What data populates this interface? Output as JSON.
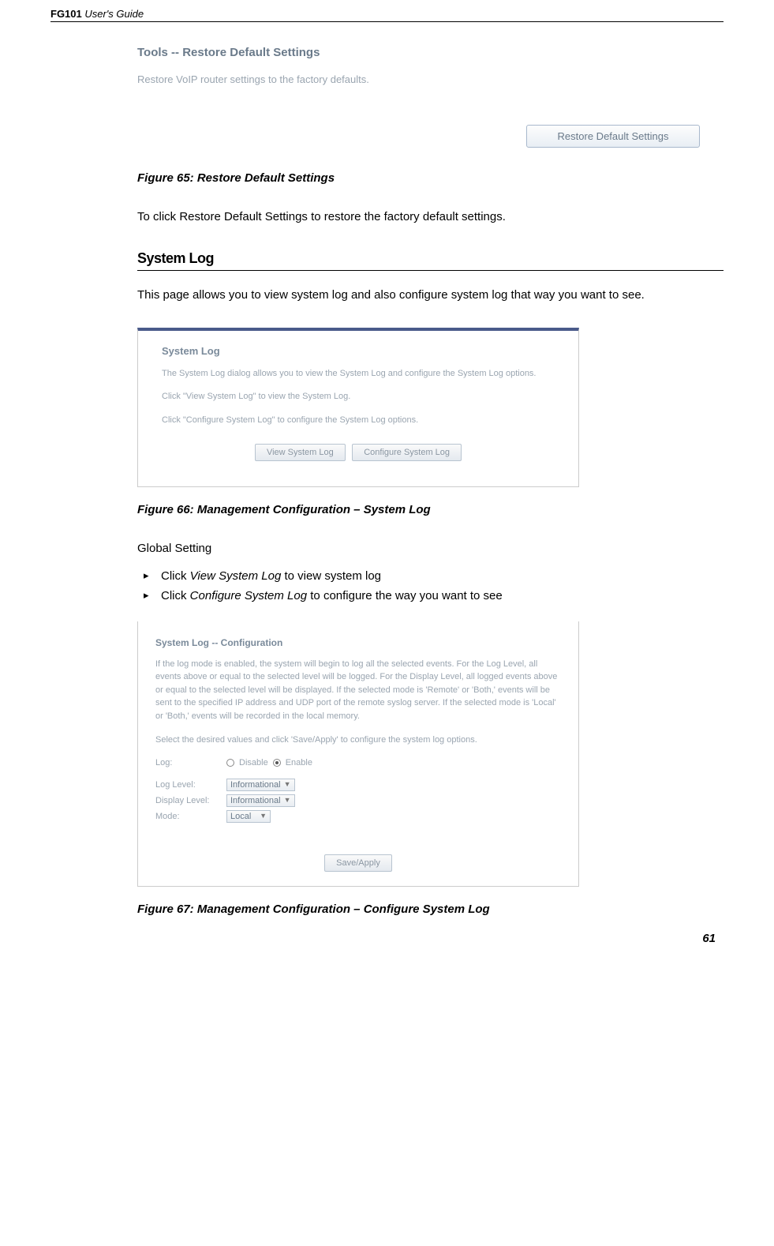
{
  "header": {
    "product": "FG101",
    "subtitle": "User's Guide"
  },
  "restore": {
    "title": "Tools -- Restore Default Settings",
    "desc": "Restore VoIP router settings to the factory defaults.",
    "button": "Restore Default Settings"
  },
  "figure65_caption": "Figure 65: Restore Default Settings",
  "restore_body": "To click Restore Default Settings to restore the factory default settings.",
  "section_heading": "System Log",
  "syslog_intro": "This page allows you to view system log and also configure system log that way you want to see.",
  "syslog": {
    "title": "System Log",
    "line1": "The System Log dialog allows you to view the System Log and configure the System Log options.",
    "line2": "Click \"View System Log\" to view the System Log.",
    "line3": "Click \"Configure System Log\" to configure the System Log options.",
    "btn_view": "View System Log",
    "btn_config": "Configure System Log"
  },
  "figure66_caption": "Figure 66: Management Configuration – System Log",
  "global_setting_label": "Global Setting",
  "bullets": {
    "b1_prefix": "Click ",
    "b1_italic": "View System Log",
    "b1_suffix": " to view system log",
    "b2_prefix": "Click ",
    "b2_italic": "Configure System Log",
    "b2_suffix": " to configure the way you want to see"
  },
  "config": {
    "title": "System Log -- Configuration",
    "para1": "If the log mode is enabled, the system will begin to log all the selected events. For the Log Level, all events above or equal to the selected level will be logged. For the Display Level, all logged events above or equal to the selected level will be displayed. If the selected mode is 'Remote' or 'Both,' events will be sent to the specified IP address and UDP port of the remote syslog server. If the selected mode is 'Local' or 'Both,' events will be recorded in the local memory.",
    "para2": "Select the desired values and click 'Save/Apply' to configure the system log options.",
    "log_label": "Log:",
    "radio_disable": "Disable",
    "radio_enable": "Enable",
    "loglevel_label": "Log Level:",
    "loglevel_value": "Informational",
    "displevel_label": "Display Level:",
    "displevel_value": "Informational",
    "mode_label": "Mode:",
    "mode_value": "Local",
    "save_btn": "Save/Apply"
  },
  "figure67_caption": "Figure 67: Management Configuration – Configure System Log",
  "page_number": "61"
}
